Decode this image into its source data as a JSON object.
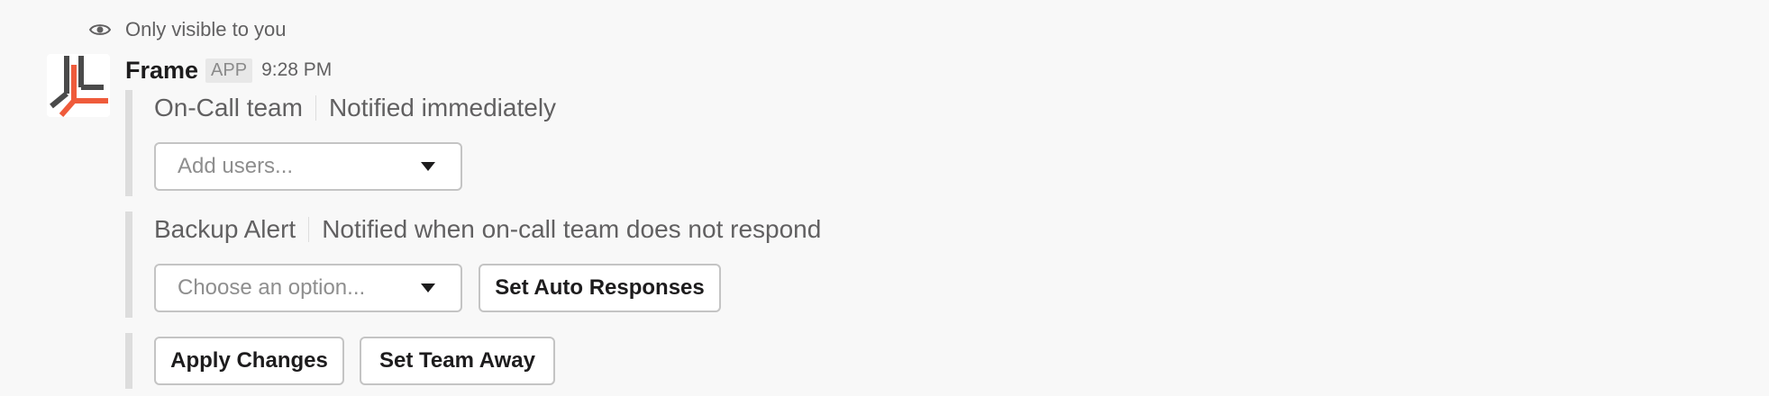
{
  "notice": {
    "text": "Only visible to you"
  },
  "message": {
    "app_name": "Frame",
    "badge": "APP",
    "time": "9:28 PM"
  },
  "on_call": {
    "title": "On-Call team",
    "description": "Notified immediately",
    "select_placeholder": "Add users..."
  },
  "backup": {
    "title": "Backup Alert",
    "description": "Notified when on-call team does not respond",
    "select_placeholder": "Choose an option...",
    "button_label": "Set Auto Responses"
  },
  "actions": {
    "apply_label": "Apply Changes",
    "away_label": "Set Team Away"
  },
  "colors": {
    "logo_dark": "#4a4a4a",
    "logo_accent": "#ef5b3b"
  }
}
